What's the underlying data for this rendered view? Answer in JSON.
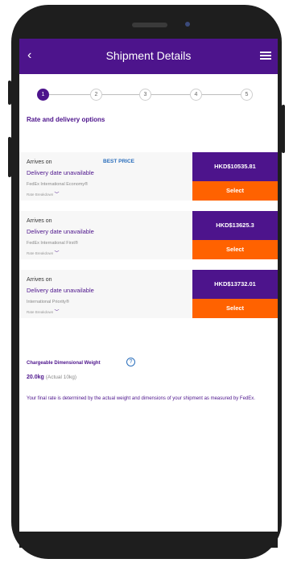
{
  "header": {
    "title": "Shipment Details",
    "back_icon": "‹"
  },
  "steps": [
    "1",
    "2",
    "3",
    "4",
    "5"
  ],
  "heading": "Rate and delivery options",
  "options": [
    {
      "arrives": "Arrives on",
      "badge": "BEST PRICE",
      "delivery": "Delivery date unavailable",
      "service": "FedEx International Economy®",
      "rate": "Rate Breakdown",
      "price": "HKD$10535.81",
      "select": "Select"
    },
    {
      "arrives": "Arrives on",
      "badge": "",
      "delivery": "Delivery date unavailable",
      "service": "FedEx International First®",
      "rate": "Rate Breakdown",
      "price": "HKD$13625.3",
      "select": "Select"
    },
    {
      "arrives": "Arrives on",
      "badge": "",
      "delivery": "Delivery date unavailable",
      "service": "International Priority®",
      "rate": "Rate Breakdown",
      "price": "HKD$13732.01",
      "select": "Select"
    }
  ],
  "chargeable": {
    "title": "Chargeable Dimensional Weight",
    "weight": "20.0kg",
    "actual": "(Actual 10kg)"
  },
  "note": "Your final rate is determined by the actual weight and dimensions of your shipment as measured by FedEx.",
  "colors": {
    "brand": "#4d148c",
    "accent": "#ff6200",
    "link": "#2a6ebc"
  }
}
